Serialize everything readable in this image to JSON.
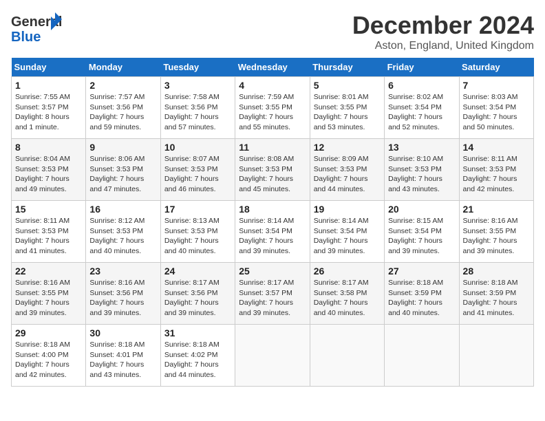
{
  "header": {
    "logo_general": "General",
    "logo_blue": "Blue",
    "month": "December 2024",
    "location": "Aston, England, United Kingdom"
  },
  "weekdays": [
    "Sunday",
    "Monday",
    "Tuesday",
    "Wednesday",
    "Thursday",
    "Friday",
    "Saturday"
  ],
  "weeks": [
    [
      {
        "day": "1",
        "sunrise": "Sunrise: 7:55 AM",
        "sunset": "Sunset: 3:57 PM",
        "daylight": "Daylight: 8 hours and 1 minute."
      },
      {
        "day": "2",
        "sunrise": "Sunrise: 7:57 AM",
        "sunset": "Sunset: 3:56 PM",
        "daylight": "Daylight: 7 hours and 59 minutes."
      },
      {
        "day": "3",
        "sunrise": "Sunrise: 7:58 AM",
        "sunset": "Sunset: 3:56 PM",
        "daylight": "Daylight: 7 hours and 57 minutes."
      },
      {
        "day": "4",
        "sunrise": "Sunrise: 7:59 AM",
        "sunset": "Sunset: 3:55 PM",
        "daylight": "Daylight: 7 hours and 55 minutes."
      },
      {
        "day": "5",
        "sunrise": "Sunrise: 8:01 AM",
        "sunset": "Sunset: 3:55 PM",
        "daylight": "Daylight: 7 hours and 53 minutes."
      },
      {
        "day": "6",
        "sunrise": "Sunrise: 8:02 AM",
        "sunset": "Sunset: 3:54 PM",
        "daylight": "Daylight: 7 hours and 52 minutes."
      },
      {
        "day": "7",
        "sunrise": "Sunrise: 8:03 AM",
        "sunset": "Sunset: 3:54 PM",
        "daylight": "Daylight: 7 hours and 50 minutes."
      }
    ],
    [
      {
        "day": "8",
        "sunrise": "Sunrise: 8:04 AM",
        "sunset": "Sunset: 3:53 PM",
        "daylight": "Daylight: 7 hours and 49 minutes."
      },
      {
        "day": "9",
        "sunrise": "Sunrise: 8:06 AM",
        "sunset": "Sunset: 3:53 PM",
        "daylight": "Daylight: 7 hours and 47 minutes."
      },
      {
        "day": "10",
        "sunrise": "Sunrise: 8:07 AM",
        "sunset": "Sunset: 3:53 PM",
        "daylight": "Daylight: 7 hours and 46 minutes."
      },
      {
        "day": "11",
        "sunrise": "Sunrise: 8:08 AM",
        "sunset": "Sunset: 3:53 PM",
        "daylight": "Daylight: 7 hours and 45 minutes."
      },
      {
        "day": "12",
        "sunrise": "Sunrise: 8:09 AM",
        "sunset": "Sunset: 3:53 PM",
        "daylight": "Daylight: 7 hours and 44 minutes."
      },
      {
        "day": "13",
        "sunrise": "Sunrise: 8:10 AM",
        "sunset": "Sunset: 3:53 PM",
        "daylight": "Daylight: 7 hours and 43 minutes."
      },
      {
        "day": "14",
        "sunrise": "Sunrise: 8:11 AM",
        "sunset": "Sunset: 3:53 PM",
        "daylight": "Daylight: 7 hours and 42 minutes."
      }
    ],
    [
      {
        "day": "15",
        "sunrise": "Sunrise: 8:11 AM",
        "sunset": "Sunset: 3:53 PM",
        "daylight": "Daylight: 7 hours and 41 minutes."
      },
      {
        "day": "16",
        "sunrise": "Sunrise: 8:12 AM",
        "sunset": "Sunset: 3:53 PM",
        "daylight": "Daylight: 7 hours and 40 minutes."
      },
      {
        "day": "17",
        "sunrise": "Sunrise: 8:13 AM",
        "sunset": "Sunset: 3:53 PM",
        "daylight": "Daylight: 7 hours and 40 minutes."
      },
      {
        "day": "18",
        "sunrise": "Sunrise: 8:14 AM",
        "sunset": "Sunset: 3:54 PM",
        "daylight": "Daylight: 7 hours and 39 minutes."
      },
      {
        "day": "19",
        "sunrise": "Sunrise: 8:14 AM",
        "sunset": "Sunset: 3:54 PM",
        "daylight": "Daylight: 7 hours and 39 minutes."
      },
      {
        "day": "20",
        "sunrise": "Sunrise: 8:15 AM",
        "sunset": "Sunset: 3:54 PM",
        "daylight": "Daylight: 7 hours and 39 minutes."
      },
      {
        "day": "21",
        "sunrise": "Sunrise: 8:16 AM",
        "sunset": "Sunset: 3:55 PM",
        "daylight": "Daylight: 7 hours and 39 minutes."
      }
    ],
    [
      {
        "day": "22",
        "sunrise": "Sunrise: 8:16 AM",
        "sunset": "Sunset: 3:55 PM",
        "daylight": "Daylight: 7 hours and 39 minutes."
      },
      {
        "day": "23",
        "sunrise": "Sunrise: 8:16 AM",
        "sunset": "Sunset: 3:56 PM",
        "daylight": "Daylight: 7 hours and 39 minutes."
      },
      {
        "day": "24",
        "sunrise": "Sunrise: 8:17 AM",
        "sunset": "Sunset: 3:56 PM",
        "daylight": "Daylight: 7 hours and 39 minutes."
      },
      {
        "day": "25",
        "sunrise": "Sunrise: 8:17 AM",
        "sunset": "Sunset: 3:57 PM",
        "daylight": "Daylight: 7 hours and 39 minutes."
      },
      {
        "day": "26",
        "sunrise": "Sunrise: 8:17 AM",
        "sunset": "Sunset: 3:58 PM",
        "daylight": "Daylight: 7 hours and 40 minutes."
      },
      {
        "day": "27",
        "sunrise": "Sunrise: 8:18 AM",
        "sunset": "Sunset: 3:59 PM",
        "daylight": "Daylight: 7 hours and 40 minutes."
      },
      {
        "day": "28",
        "sunrise": "Sunrise: 8:18 AM",
        "sunset": "Sunset: 3:59 PM",
        "daylight": "Daylight: 7 hours and 41 minutes."
      }
    ],
    [
      {
        "day": "29",
        "sunrise": "Sunrise: 8:18 AM",
        "sunset": "Sunset: 4:00 PM",
        "daylight": "Daylight: 7 hours and 42 minutes."
      },
      {
        "day": "30",
        "sunrise": "Sunrise: 8:18 AM",
        "sunset": "Sunset: 4:01 PM",
        "daylight": "Daylight: 7 hours and 43 minutes."
      },
      {
        "day": "31",
        "sunrise": "Sunrise: 8:18 AM",
        "sunset": "Sunset: 4:02 PM",
        "daylight": "Daylight: 7 hours and 44 minutes."
      },
      null,
      null,
      null,
      null
    ]
  ]
}
